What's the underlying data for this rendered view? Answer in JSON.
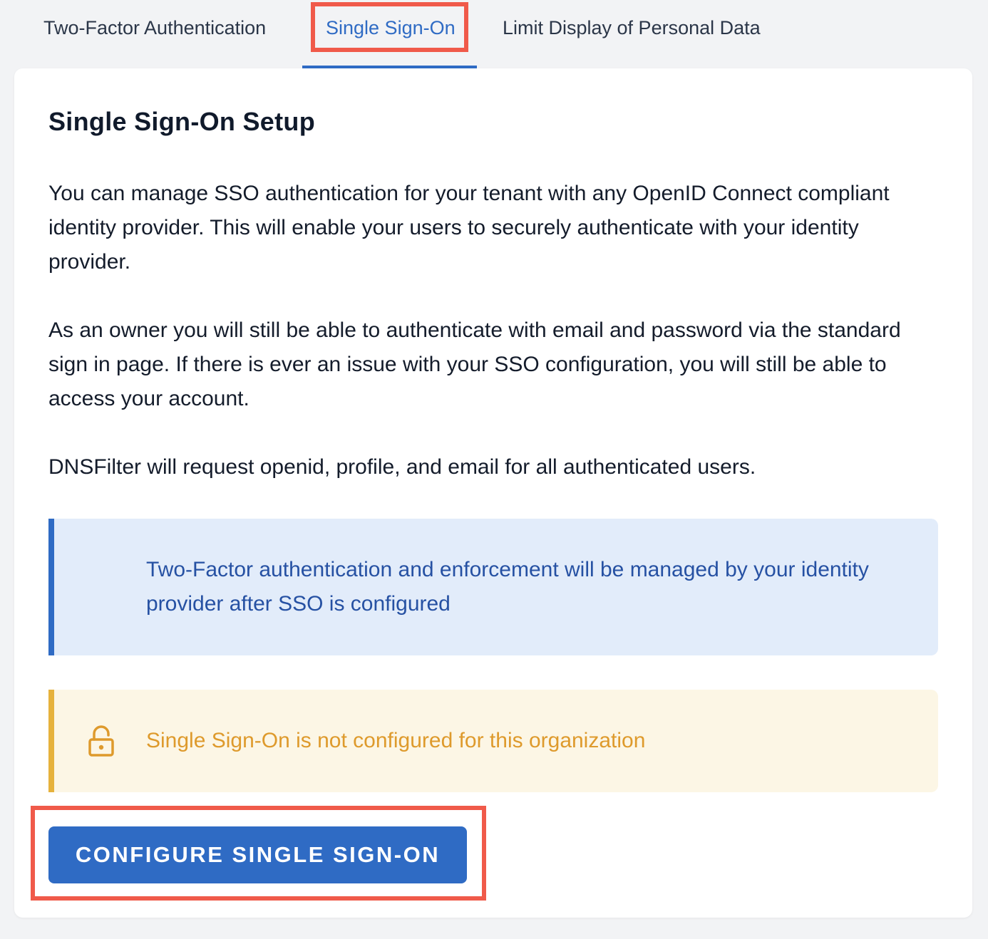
{
  "tabs": {
    "items": [
      {
        "label": "Two-Factor Authentication"
      },
      {
        "label": "Single Sign-On"
      },
      {
        "label": "Limit Display of Personal Data"
      }
    ],
    "active_tab": "Single Sign-On"
  },
  "card": {
    "title": "Single Sign-On Setup",
    "paragraphs": [
      "You can manage SSO authentication for your tenant with any OpenID Connect compliant identity provider. This will enable your users to securely authenticate with your identity provider.",
      "As an owner you will still be able to authenticate with email and password via the standard sign in page. If there is ever an issue with your SSO configuration, you will still be able to access your account.",
      "DNSFilter will request openid, profile, and email for all authenticated users."
    ],
    "info_alert": {
      "text": "Two-Factor authentication and enforcement will be managed by your identity provider after SSO is configured"
    },
    "warning_alert": {
      "icon": "lock-icon",
      "text": "Single Sign-On is not configured for this organization"
    },
    "configure_button_label": "CONFIGURE SINGLE SIGN-ON"
  },
  "colors": {
    "accent": "#2f6bc4",
    "info_background": "#e2ecfa",
    "info_text": "#2651a3",
    "warning_background": "#fcf6e5",
    "warning_border": "#e6b23c",
    "warning_text": "#de9a2c",
    "highlight_outline": "#f05a4a",
    "page_background": "#f2f3f5"
  }
}
